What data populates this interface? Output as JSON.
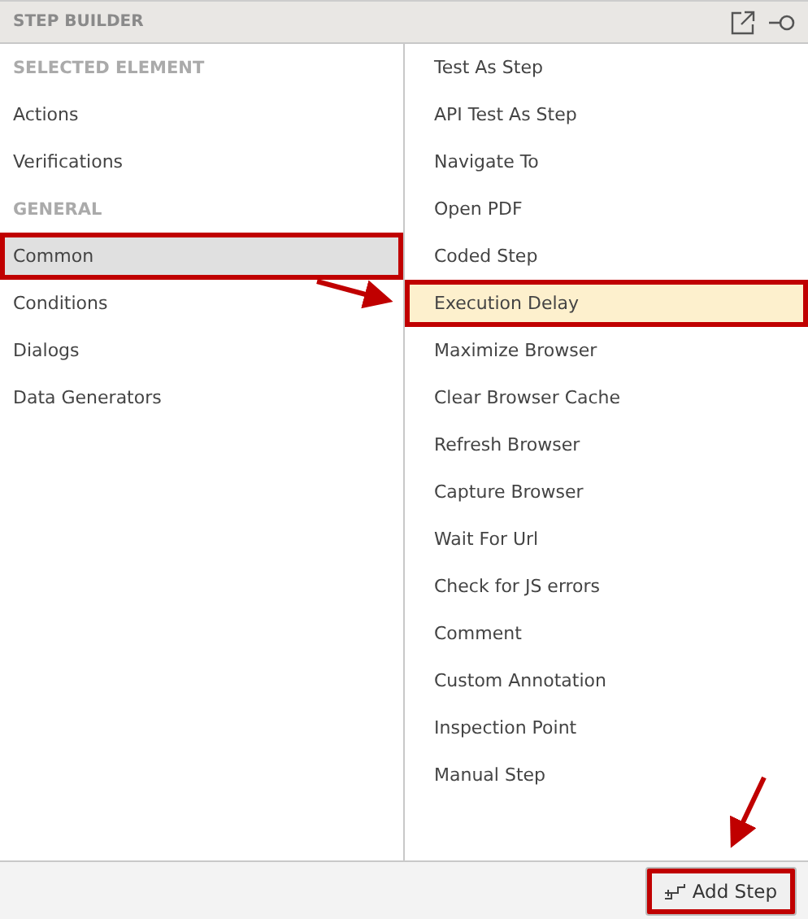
{
  "panel": {
    "title": "STEP BUILDER"
  },
  "categories": [
    {
      "kind": "heading",
      "label": "SELECTED ELEMENT"
    },
    {
      "kind": "item",
      "label": "Actions",
      "selected": false,
      "highlighted": false
    },
    {
      "kind": "item",
      "label": "Verifications",
      "selected": false,
      "highlighted": false
    },
    {
      "kind": "heading",
      "label": "GENERAL"
    },
    {
      "kind": "item",
      "label": "Common",
      "selected": true,
      "highlighted": true
    },
    {
      "kind": "item",
      "label": "Conditions",
      "selected": false,
      "highlighted": false
    },
    {
      "kind": "item",
      "label": "Dialogs",
      "selected": false,
      "highlighted": false
    },
    {
      "kind": "item",
      "label": "Data Generators",
      "selected": false,
      "highlighted": false
    }
  ],
  "steps": [
    {
      "label": "Test As Step",
      "selected": false,
      "highlighted": false
    },
    {
      "label": "API Test As Step",
      "selected": false,
      "highlighted": false
    },
    {
      "label": "Navigate To",
      "selected": false,
      "highlighted": false
    },
    {
      "label": "Open PDF",
      "selected": false,
      "highlighted": false
    },
    {
      "label": "Coded Step",
      "selected": false,
      "highlighted": false
    },
    {
      "label": "Execution Delay",
      "selected": true,
      "highlighted": true
    },
    {
      "label": "Maximize Browser",
      "selected": false,
      "highlighted": false
    },
    {
      "label": "Clear Browser Cache",
      "selected": false,
      "highlighted": false
    },
    {
      "label": "Refresh Browser",
      "selected": false,
      "highlighted": false
    },
    {
      "label": "Capture Browser",
      "selected": false,
      "highlighted": false
    },
    {
      "label": "Wait For Url",
      "selected": false,
      "highlighted": false
    },
    {
      "label": "Check for JS errors",
      "selected": false,
      "highlighted": false
    },
    {
      "label": "Comment",
      "selected": false,
      "highlighted": false
    },
    {
      "label": "Custom Annotation",
      "selected": false,
      "highlighted": false
    },
    {
      "label": "Inspection Point",
      "selected": false,
      "highlighted": false
    },
    {
      "label": "Manual Step",
      "selected": false,
      "highlighted": false
    }
  ],
  "add_button": {
    "label": "Add Step",
    "highlighted": true
  }
}
